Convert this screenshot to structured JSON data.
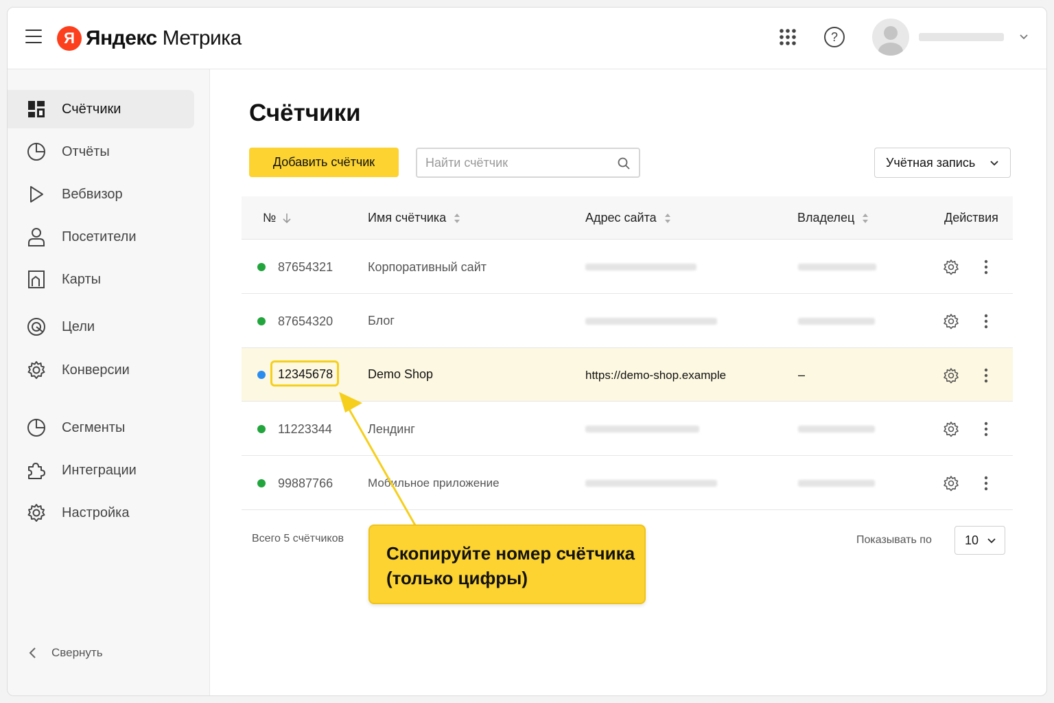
{
  "header": {
    "logo_letter": "Я",
    "logo_brand": "Яндекс",
    "logo_product": "Метрика"
  },
  "sidebar": {
    "items": [
      {
        "label": "Счётчики",
        "icon": "dashboard-icon",
        "active": true
      },
      {
        "label": "Отчёты",
        "icon": "pie-chart-icon"
      },
      {
        "label": "Вебвизор",
        "icon": "play-icon"
      },
      {
        "label": "Посетители",
        "icon": "user-icon"
      },
      {
        "label": "Карты",
        "icon": "map-icon"
      },
      {
        "label": "Цели",
        "icon": "target-icon"
      },
      {
        "label": "Конверсии",
        "icon": "gear-icon"
      },
      {
        "label": "Сегменты",
        "icon": "segment-icon"
      },
      {
        "label": "Интеграции",
        "icon": "puzzle-icon"
      },
      {
        "label": "Настройка",
        "icon": "settings-icon"
      }
    ],
    "collapse_label": "Свернуть"
  },
  "main": {
    "title": "Счётчики",
    "add_button": "Добавить счётчик",
    "search_placeholder": "Найти счётчик",
    "account_select": "Учётная запись",
    "columns": [
      "№",
      "Имя счётчика",
      "Адрес сайта",
      "Владелец",
      "Действия"
    ],
    "rows": [
      {
        "id": "87654321",
        "name": "Корпоративный сайт",
        "status_color": "#22a53c"
      },
      {
        "id": "87654320",
        "name": "Блог",
        "status_color": "#22a53c"
      },
      {
        "id": "12345678",
        "name": "Demo Shop",
        "url": "https://demo-shop.example",
        "owner": "–",
        "status_color": "#2b8cf0",
        "highlighted": true
      },
      {
        "id": "11223344",
        "name": "Лендинг",
        "status_color": "#22a53c"
      },
      {
        "id": "99887766",
        "name": "Мобильное приложение",
        "status_color": "#22a53c"
      }
    ],
    "total": "Всего 5 счётчиков",
    "per_page_label": "Показывать по",
    "per_page_value": "10"
  },
  "callout": {
    "line1": "Скопируйте номер счётчика",
    "line2": "(только цифры)"
  },
  "colors": {
    "accent_yellow": "#fcd330",
    "logo_red": "#fc3f1d",
    "highlight_row": "#fdf8e1"
  }
}
